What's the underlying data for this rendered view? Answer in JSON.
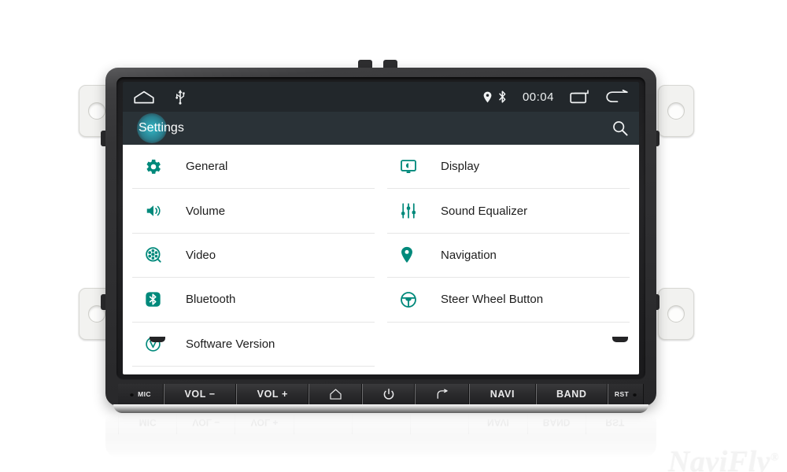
{
  "device": {
    "brand_watermark": "NaviFly",
    "brand_watermark_mark": "®"
  },
  "status_bar": {
    "home_icon": "home-icon",
    "usb_icon": "usb-icon",
    "location_icon": "location-pin-icon",
    "bluetooth_icon": "bluetooth-icon",
    "clock": "00:04",
    "recents_icon": "recents-icon",
    "back_icon": "back-arrow-icon"
  },
  "action_bar": {
    "title": "Settings",
    "search_icon": "search-icon",
    "accent_color": "#2aa8bd",
    "background_color": "#2a3237"
  },
  "settings": {
    "icon_color": "#00897b",
    "left_column": [
      {
        "label": "General",
        "icon": "gear-icon"
      },
      {
        "label": "Volume",
        "icon": "speaker-icon"
      },
      {
        "label": "Video",
        "icon": "film-reel-icon"
      },
      {
        "label": "Bluetooth",
        "icon": "bluetooth-icon"
      },
      {
        "label": "Software Version",
        "icon": "version-v-icon"
      }
    ],
    "right_column": [
      {
        "label": "Display",
        "icon": "monitor-brightness-icon"
      },
      {
        "label": "Sound Equalizer",
        "icon": "equalizer-sliders-icon"
      },
      {
        "label": "Navigation",
        "icon": "location-pin-icon"
      },
      {
        "label": "Steer Wheel Button",
        "icon": "steering-wheel-icon"
      },
      {
        "label": "",
        "icon": ""
      }
    ]
  },
  "hardware_buttons": [
    {
      "label": "MIC",
      "icon": "microphone-hole-icon",
      "type": "mic"
    },
    {
      "label": "VOL −",
      "icon": "",
      "type": "text"
    },
    {
      "label": "VOL +",
      "icon": "",
      "type": "text"
    },
    {
      "label": "",
      "icon": "home-icon",
      "type": "icon"
    },
    {
      "label": "",
      "icon": "power-icon",
      "type": "icon"
    },
    {
      "label": "",
      "icon": "back-arrow-icon",
      "type": "icon"
    },
    {
      "label": "NAVI",
      "icon": "",
      "type": "text"
    },
    {
      "label": "BAND",
      "icon": "",
      "type": "text"
    },
    {
      "label": "RST",
      "icon": "reset-hole-icon",
      "type": "rst"
    }
  ],
  "reflection_labels": [
    "MIC",
    "VOL −",
    "VOL +",
    "",
    "",
    "",
    "NAVI",
    "BAND",
    "RST"
  ]
}
